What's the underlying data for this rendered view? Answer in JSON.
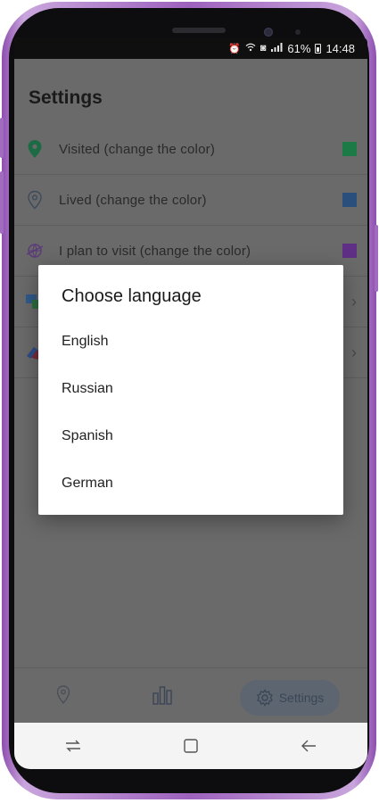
{
  "status_bar": {
    "battery": "61%",
    "time": "14:48"
  },
  "header": {
    "title": "Settings"
  },
  "settings_rows": [
    {
      "label": "Visited (change the color)",
      "color": "#1c8a4f",
      "icon": "map-pin-filled-icon"
    },
    {
      "label": "Lived (change the color)",
      "color": "#2c5d9a",
      "icon": "map-pin-outline-icon"
    },
    {
      "label": "I plan to visit (change the color)",
      "color": "#6f3a9c",
      "icon": "globe-plane-icon"
    },
    {
      "label": "",
      "icon": "translate-icon"
    },
    {
      "label": "",
      "icon": "eraser-icon"
    }
  ],
  "dialog": {
    "title": "Choose language",
    "options": [
      "English",
      "Russian",
      "Spanish",
      "German"
    ]
  },
  "tab_bar": {
    "settings_label": "Settings",
    "tabs": [
      "map-pin-icon",
      "bar-chart-icon",
      "gear-icon"
    ]
  },
  "colors": {
    "accent": "#394656",
    "overlay": "#6a6a6a",
    "frame": "#9d62bd"
  }
}
